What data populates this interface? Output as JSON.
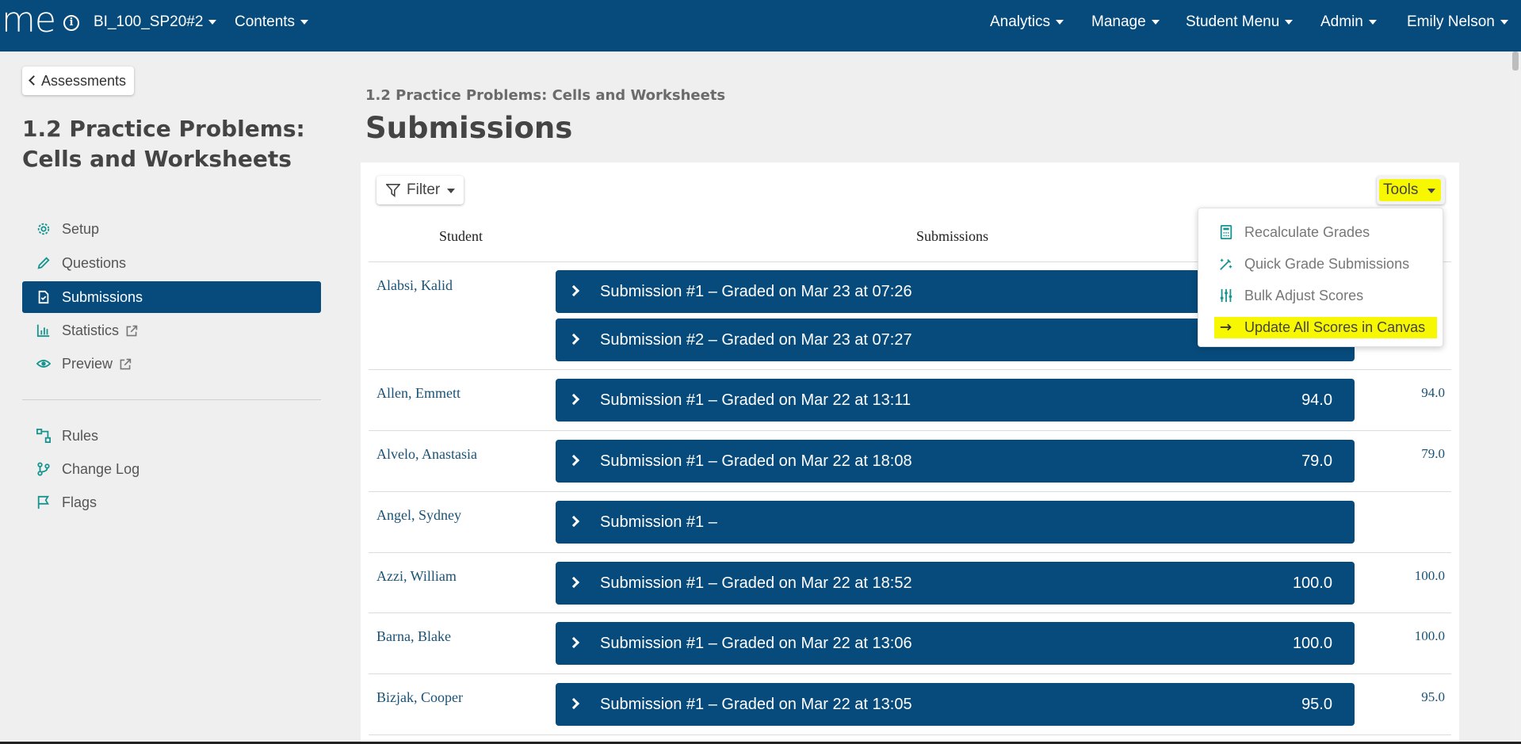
{
  "topnav": {
    "logo": "me",
    "course": "BI_100_SP20#2",
    "contents": "Contents",
    "analytics": "Analytics",
    "manage": "Manage",
    "student_menu": "Student Menu",
    "admin": "Admin",
    "user": "Emily Nelson"
  },
  "sidebar": {
    "back_label": "Assessments",
    "assessment_title": "1.2 Practice Problems: Cells and Worksheets",
    "items": [
      {
        "label": "Setup",
        "icon": "gear-icon"
      },
      {
        "label": "Questions",
        "icon": "pencil-icon"
      },
      {
        "label": "Submissions",
        "icon": "document-icon",
        "active": true
      },
      {
        "label": "Statistics",
        "icon": "bar-chart-icon"
      },
      {
        "label": "Preview",
        "icon": "eye-icon"
      },
      {
        "label": "Rules",
        "icon": "flowchart-icon"
      },
      {
        "label": "Change Log",
        "icon": "branch-icon"
      },
      {
        "label": "Flags",
        "icon": "flag-icon"
      }
    ]
  },
  "main": {
    "breadcrumb": "1.2 Practice Problems: Cells and Worksheets",
    "title": "Submissions",
    "filter_label": "Filter",
    "tools_label": "Tools",
    "columns": {
      "student": "Student",
      "submissions": "Submissions"
    },
    "rows": [
      {
        "student": "Alabsi, Kalid",
        "final": "",
        "submissions": [
          {
            "text": "Submission #1 – Graded on Mar 23 at 07:26",
            "score": ""
          },
          {
            "text": "Submission #2 – Graded on Mar 23 at 07:27",
            "score": ""
          }
        ]
      },
      {
        "student": "Allen, Emmett",
        "final": "94.0",
        "submissions": [
          {
            "text": "Submission #1 – Graded on Mar 22 at 13:11",
            "score": "94.0"
          }
        ]
      },
      {
        "student": "Alvelo, Anastasia",
        "final": "79.0",
        "submissions": [
          {
            "text": "Submission #1 – Graded on Mar 22 at 18:08",
            "score": "79.0"
          }
        ]
      },
      {
        "student": "Angel, Sydney",
        "final": "",
        "submissions": [
          {
            "text": "Submission #1 –",
            "score": ""
          }
        ]
      },
      {
        "student": "Azzi, William",
        "final": "100.0",
        "submissions": [
          {
            "text": "Submission #1 – Graded on Mar 22 at 18:52",
            "score": "100.0"
          }
        ]
      },
      {
        "student": "Barna, Blake",
        "final": "100.0",
        "submissions": [
          {
            "text": "Submission #1 – Graded on Mar 22 at 13:06",
            "score": "100.0"
          }
        ]
      },
      {
        "student": "Bizjak, Cooper",
        "final": "95.0",
        "submissions": [
          {
            "text": "Submission #1 – Graded on Mar 22 at 13:05",
            "score": "95.0"
          }
        ]
      }
    ]
  },
  "tools_menu": {
    "items": [
      {
        "label": "Recalculate Grades",
        "icon": "calculator-icon"
      },
      {
        "label": "Quick Grade Submissions",
        "icon": "magic-wand-icon"
      },
      {
        "label": "Bulk Adjust Scores",
        "icon": "sliders-icon"
      },
      {
        "label": "Update All Scores in Canvas",
        "icon": "arrow-right-icon",
        "highlighted": true
      }
    ]
  },
  "colors": {
    "nav": "#074b7c",
    "accent": "#17948f",
    "highlight": "#f7f700"
  }
}
